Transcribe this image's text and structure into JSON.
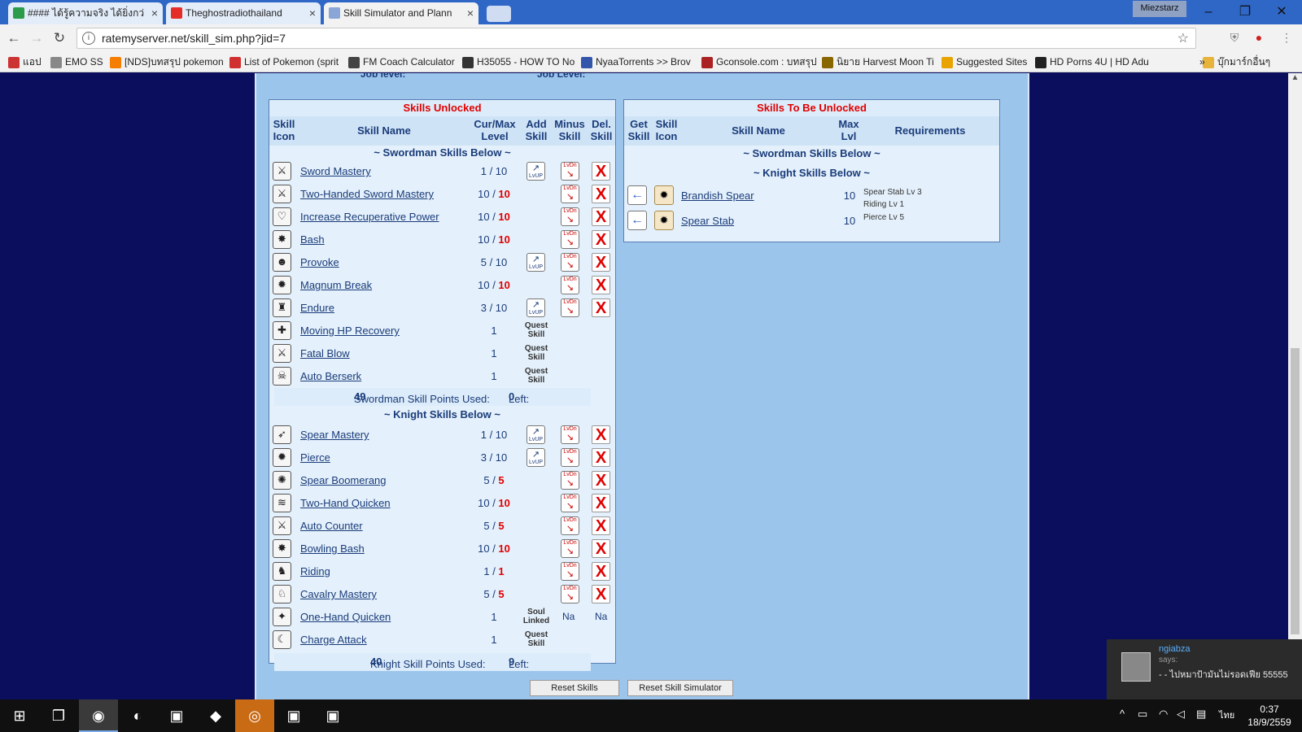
{
  "browser": {
    "tabs": [
      {
        "label": "#### ได้รู้ความจริง ได้ยิ่งกว่",
        "fav": "#2c9b4a",
        "active": false
      },
      {
        "label": "Theghostradiothailand",
        "fav": "#e52d27",
        "active": false
      },
      {
        "label": "Skill Simulator and Plann",
        "fav": "#8aa6d6",
        "active": true
      }
    ],
    "profile": "Miezstarz",
    "url": "ratemyserver.net/skill_sim.php?jid=7",
    "bookmarks": [
      {
        "label": "แอป",
        "color": "#cc3333"
      },
      {
        "label": "EMO SS",
        "color": "#888888"
      },
      {
        "label": "[NDS]บทสรุป pokemon",
        "color": "#f57d00"
      },
      {
        "label": "List of Pokemon (sprit",
        "color": "#d03030"
      },
      {
        "label": "FM Coach Calculator",
        "color": "#444444"
      },
      {
        "label": "H35055 - HOW TO No",
        "color": "#333333"
      },
      {
        "label": "NyaaTorrents >> Brov",
        "color": "#3355aa"
      },
      {
        "label": "Gconsole.com : บทสรุป",
        "color": "#aa2222"
      },
      {
        "label": "นิยาย Harvest Moon Ti",
        "color": "#886600"
      },
      {
        "label": "Suggested Sites",
        "color": "#e8a300"
      },
      {
        "label": "HD Porns 4U | HD Adu",
        "color": "#222222"
      },
      {
        "label": "บุ๊กมาร์กอื่นๆ",
        "color": "#e8b33a"
      }
    ]
  },
  "page": {
    "job_level_left": "Job level:",
    "job_level_right": "Job Level:",
    "unlocked": {
      "title": "Skills Unlocked",
      "headers": {
        "icon": [
          "Skill",
          "Icon"
        ],
        "name": "Skill Name",
        "level": [
          "Cur/Max",
          "Level"
        ],
        "add": [
          "Add",
          "Skill"
        ],
        "minus": [
          "Minus",
          "Skill"
        ],
        "del": [
          "Del.",
          "Skill"
        ]
      },
      "swordman_section": "~ Swordman Skills Below ~",
      "swordman": [
        {
          "name": "Sword Mastery",
          "cur": "1",
          "max": "10",
          "maxed": false,
          "add": true,
          "minus": true,
          "del": true,
          "note": "",
          "icon": "⚔"
        },
        {
          "name": "Two-Handed Sword Mastery",
          "cur": "10",
          "max": "10",
          "maxed": true,
          "add": false,
          "minus": true,
          "del": true,
          "note": "",
          "icon": "⚔"
        },
        {
          "name": "Increase Recuperative Power",
          "cur": "10",
          "max": "10",
          "maxed": true,
          "add": false,
          "minus": true,
          "del": true,
          "note": "",
          "icon": "♡"
        },
        {
          "name": "Bash",
          "cur": "10",
          "max": "10",
          "maxed": true,
          "add": false,
          "minus": true,
          "del": true,
          "note": "",
          "icon": "✸"
        },
        {
          "name": "Provoke",
          "cur": "5",
          "max": "10",
          "maxed": false,
          "add": true,
          "minus": true,
          "del": true,
          "note": "",
          "icon": "☻"
        },
        {
          "name": "Magnum Break",
          "cur": "10",
          "max": "10",
          "maxed": true,
          "add": false,
          "minus": true,
          "del": true,
          "note": "",
          "icon": "✹"
        },
        {
          "name": "Endure",
          "cur": "3",
          "max": "10",
          "maxed": false,
          "add": true,
          "minus": true,
          "del": true,
          "note": "",
          "icon": "♜"
        },
        {
          "name": "Moving HP Recovery",
          "cur": "1",
          "max": "",
          "maxed": false,
          "add": false,
          "minus": false,
          "del": false,
          "note": "Quest Skill",
          "icon": "✚"
        },
        {
          "name": "Fatal Blow",
          "cur": "1",
          "max": "",
          "maxed": false,
          "add": false,
          "minus": false,
          "del": false,
          "note": "Quest Skill",
          "icon": "⚔"
        },
        {
          "name": "Auto Berserk",
          "cur": "1",
          "max": "",
          "maxed": false,
          "add": false,
          "minus": false,
          "del": false,
          "note": "Quest Skill",
          "icon": "☠"
        }
      ],
      "swordman_points_label": "Swordman Skill Points Used:",
      "swordman_points": "49",
      "swordman_left_label": "Left:",
      "swordman_left": "0",
      "knight_section": "~ Knight Skills Below ~",
      "knight": [
        {
          "name": "Spear Mastery",
          "cur": "1",
          "max": "10",
          "maxed": false,
          "add": true,
          "minus": true,
          "del": true,
          "note": "",
          "icon": "➶"
        },
        {
          "name": "Pierce",
          "cur": "3",
          "max": "10",
          "maxed": false,
          "add": true,
          "minus": true,
          "del": true,
          "note": "",
          "icon": "✹"
        },
        {
          "name": "Spear Boomerang",
          "cur": "5",
          "max": "5",
          "maxed": true,
          "add": false,
          "minus": true,
          "del": true,
          "note": "",
          "icon": "✺"
        },
        {
          "name": "Two-Hand Quicken",
          "cur": "10",
          "max": "10",
          "maxed": true,
          "add": false,
          "minus": true,
          "del": true,
          "note": "",
          "icon": "≋"
        },
        {
          "name": "Auto Counter",
          "cur": "5",
          "max": "5",
          "maxed": true,
          "add": false,
          "minus": true,
          "del": true,
          "note": "",
          "icon": "⚔"
        },
        {
          "name": "Bowling Bash",
          "cur": "10",
          "max": "10",
          "maxed": true,
          "add": false,
          "minus": true,
          "del": true,
          "note": "",
          "icon": "✸"
        },
        {
          "name": "Riding",
          "cur": "1",
          "max": "1",
          "maxed": true,
          "add": false,
          "minus": true,
          "del": true,
          "note": "",
          "icon": "♞"
        },
        {
          "name": "Cavalry Mastery",
          "cur": "5",
          "max": "5",
          "maxed": true,
          "add": false,
          "minus": true,
          "del": true,
          "note": "",
          "icon": "♘"
        },
        {
          "name": "One-Hand Quicken",
          "cur": "1",
          "max": "",
          "maxed": false,
          "add": false,
          "minus": false,
          "del": false,
          "note": "Soul Linked",
          "na": "Na",
          "icon": "✦"
        },
        {
          "name": "Charge Attack",
          "cur": "1",
          "max": "",
          "maxed": false,
          "add": false,
          "minus": false,
          "del": false,
          "note": "Quest Skill",
          "icon": "☾"
        }
      ],
      "knight_points_label": "Knight Skill Points Used:",
      "knight_points": "40",
      "knight_left_label": "Left:",
      "knight_left": "9",
      "add_btn_text": "LvUP",
      "minus_btn_text": "LvDn",
      "del_btn_text": "X"
    },
    "to_unlock": {
      "title": "Skills To Be Unlocked",
      "headers": {
        "get": [
          "Get",
          "Skill"
        ],
        "icon": [
          "Skill",
          "Icon"
        ],
        "name": "Skill Name",
        "max": [
          "Max",
          "Lvl"
        ],
        "req": "Requirements"
      },
      "swordman_section": "~ Swordman Skills Below ~",
      "knight_section": "~ Knight Skills Below ~",
      "knight": [
        {
          "name": "Brandish Spear",
          "max": "10",
          "req1": "Spear Stab Lv 3",
          "req2": "Riding Lv 1",
          "icon": "✹"
        },
        {
          "name": "Spear Stab",
          "max": "10",
          "req1": "Pierce Lv 5",
          "req2": "",
          "icon": "✹"
        }
      ],
      "get_btn_text": "←"
    },
    "bottom_buttons": [
      "Reset Skills",
      "Reset Skill Simulator"
    ]
  },
  "chat": {
    "name": "ngiabza",
    "says": "says:",
    "message": "- - ไปหมาป้ามันไม่รอดเฟีย 55555"
  },
  "taskbar": {
    "time": "0:37",
    "date": "18/9/2559",
    "lang": "ไทย"
  }
}
